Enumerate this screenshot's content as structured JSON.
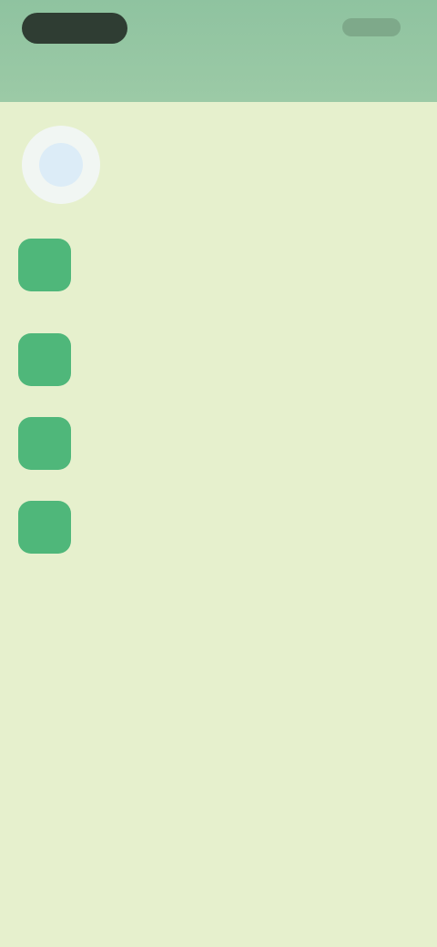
{
  "header": {
    "status_left": "",
    "status_right": "",
    "title": ""
  },
  "profile": {
    "name": ""
  },
  "list_items": [
    {
      "text": ""
    },
    {
      "text": ""
    },
    {
      "text": ""
    },
    {
      "text": ""
    }
  ],
  "colors": {
    "header": "#8fc3a0",
    "background": "#e6f0cd",
    "icon": "#4fb77a"
  }
}
